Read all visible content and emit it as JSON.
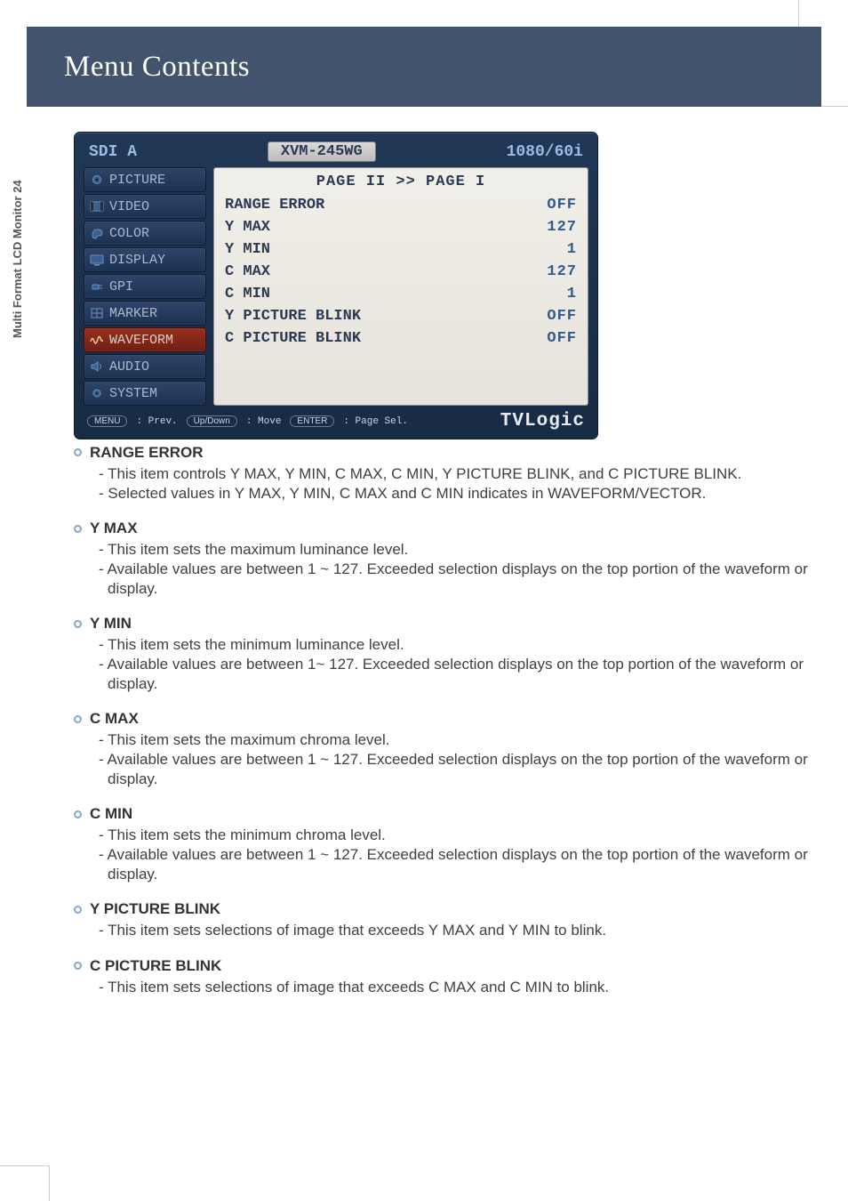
{
  "header": {
    "title": "Menu Contents"
  },
  "side_label": "Multi Format LCD Monitor 24",
  "osd": {
    "source": "SDI A",
    "model": "XVM-245WG",
    "format": "1080/60i",
    "page_header": "PAGE II >> PAGE I",
    "sidebar": [
      {
        "key": "picture",
        "label": "PICTURE",
        "selected": false,
        "icon": "gear"
      },
      {
        "key": "video",
        "label": "VIDEO",
        "selected": false,
        "icon": "film"
      },
      {
        "key": "color",
        "label": "COLOR",
        "selected": false,
        "icon": "palette"
      },
      {
        "key": "display",
        "label": "DISPLAY",
        "selected": false,
        "icon": "monitor"
      },
      {
        "key": "gpi",
        "label": "GPI",
        "selected": false,
        "icon": "plug"
      },
      {
        "key": "marker",
        "label": "MARKER",
        "selected": false,
        "icon": "grid"
      },
      {
        "key": "waveform",
        "label": "WAVEFORM",
        "selected": true,
        "icon": "wave"
      },
      {
        "key": "audio",
        "label": "AUDIO",
        "selected": false,
        "icon": "speaker"
      },
      {
        "key": "system",
        "label": "SYSTEM",
        "selected": false,
        "icon": "cog"
      }
    ],
    "rows": [
      {
        "label": "RANGE ERROR",
        "value": "OFF"
      },
      {
        "label": "Y MAX",
        "value": "127"
      },
      {
        "label": "Y MIN",
        "value": "1"
      },
      {
        "label": "C MAX",
        "value": "127"
      },
      {
        "label": "C MIN",
        "value": "1"
      },
      {
        "label": "Y PICTURE BLINK",
        "value": "OFF"
      },
      {
        "label": "C PICTURE BLINK",
        "value": "OFF"
      }
    ],
    "footer": {
      "menu_chip": "MENU",
      "menu_txt": ": Prev.",
      "ud_chip": "Up/Down",
      "ud_txt": ": Move",
      "enter_chip": "ENTER",
      "enter_txt": ": Page Sel.",
      "brand": "TVLogic"
    }
  },
  "sections": [
    {
      "title": "RANGE  ERROR",
      "lines": [
        "- This item controls Y MAX, Y MIN, C MAX, C MIN, Y PICTURE BLINK, and C PICTURE BLINK.",
        "- Selected values in Y MAX, Y MIN, C MAX and C MIN indicates in WAVEFORM/VECTOR."
      ]
    },
    {
      "title": "Y MAX",
      "lines": [
        "- This item sets the maximum luminance level.",
        "- Available values are between 1 ~ 127. Exceeded selection displays on the top portion of the waveform or display."
      ]
    },
    {
      "title": "Y MIN",
      "lines": [
        "- This item sets the minimum luminance level.",
        "- Available values are between 1~ 127. Exceeded selection displays on the top portion of the waveform or display."
      ]
    },
    {
      "title": "C MAX",
      "lines": [
        "- This item sets the maximum chroma level.",
        "- Available values are between 1 ~ 127. Exceeded selection displays on the top portion of the waveform or display."
      ]
    },
    {
      "title": "C MIN",
      "lines": [
        "- This item sets the minimum chroma level.",
        "- Available values are between 1 ~ 127. Exceeded selection displays on the top portion of the waveform or display."
      ]
    },
    {
      "title": "Y PICTURE BLINK",
      "lines": [
        "- This item sets selections of image that exceeds Y MAX and Y MIN to blink."
      ]
    },
    {
      "title": "C PICTURE BLINK",
      "lines": [
        "- This item sets selections of image that exceeds C MAX and C MIN to blink."
      ]
    }
  ]
}
